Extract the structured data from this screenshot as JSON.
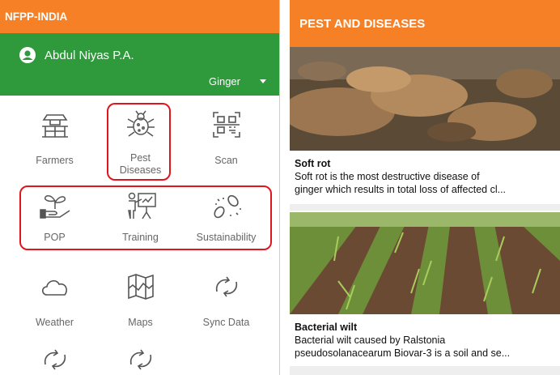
{
  "left": {
    "app_title": "NFPP-INDIA",
    "user": {
      "name": "Abdul Niyas P.A."
    },
    "crop": {
      "selected": "Ginger"
    },
    "tiles": [
      {
        "label": "Farmers",
        "icon": "farmer-icon"
      },
      {
        "label": "Pest\nDiseases",
        "icon": "bug-icon"
      },
      {
        "label": "Scan",
        "icon": "qr-scan-icon"
      },
      {
        "label": "POP",
        "icon": "plant-hand-icon"
      },
      {
        "label": "Training",
        "icon": "presentation-icon"
      },
      {
        "label": "Sustainability",
        "icon": "seeds-icon"
      },
      {
        "label": "Weather",
        "icon": "cloud-icon"
      },
      {
        "label": "Maps",
        "icon": "map-icon"
      },
      {
        "label": "Sync Data",
        "icon": "sync-icon"
      }
    ],
    "highlight_color": "#e0161c"
  },
  "right": {
    "title": "PEST AND DISEASES",
    "cards": [
      {
        "title": "Soft rot",
        "desc": "Soft rot is the most destructive disease of",
        "desc2": "ginger which results in total loss of affected cl...",
        "image": "ginger-rhizome-image"
      },
      {
        "title": "Bacterial wilt",
        "desc": "Bacterial wilt caused by Ralstonia",
        "desc2": "pseudosolanacearum Biovar-3 is a soil and se...",
        "image": "ginger-field-image"
      }
    ]
  },
  "colors": {
    "appbar": "#f58025",
    "user_bg": "#2f9a3c"
  }
}
